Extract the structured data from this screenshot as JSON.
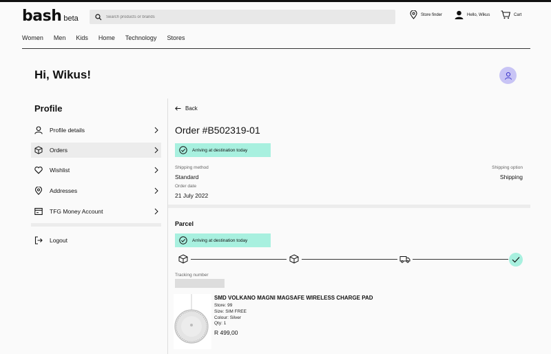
{
  "header": {
    "logo": "bash",
    "logo_tag": "beta",
    "search_placeholder": "Search products or brands",
    "store_finder": "Store finder",
    "greeting_short": "Hello, Wikus",
    "cart": "Cart"
  },
  "nav": [
    "Women",
    "Men",
    "Kids",
    "Home",
    "Technology",
    "Stores"
  ],
  "page": {
    "greeting": "Hi, Wikus!"
  },
  "sidebar": {
    "title": "Profile",
    "items": [
      {
        "label": "Profile details",
        "icon": "user-icon"
      },
      {
        "label": "Orders",
        "icon": "box-icon"
      },
      {
        "label": "Wishlist",
        "icon": "heart-icon"
      },
      {
        "label": "Addresses",
        "icon": "location-pin-icon"
      },
      {
        "label": "TFG Money Account",
        "icon": "card-icon"
      }
    ],
    "active_index": 1,
    "logout": "Logout"
  },
  "order": {
    "back": "Back",
    "title": "Order #B502319-01",
    "status": "Arriving at destination today",
    "shipping_method_label": "Shipping method",
    "shipping_method": "Standard",
    "shipping_option_label": "Shipping option",
    "shipping_option": "Shipping",
    "order_date_label": "Order date",
    "order_date": "21 July 2022"
  },
  "parcel": {
    "title": "Parcel",
    "status": "Arriving at destination today",
    "tracking_label": "Tracking number",
    "steps": [
      "box-icon",
      "box-icon",
      "truck-icon",
      "check-icon"
    ]
  },
  "product": {
    "name": "SMD VOLKANO MAGNI MAGSAFE WIRELESS CHARGE PAD",
    "store": "Store: 99",
    "size": "Size: SIM FREE",
    "colour": "Colour: Silver",
    "qty": "Qty: 1",
    "price": "R 499,00"
  },
  "colors": {
    "accent": "#a8f0df",
    "avatar": "#c8c4f5"
  }
}
